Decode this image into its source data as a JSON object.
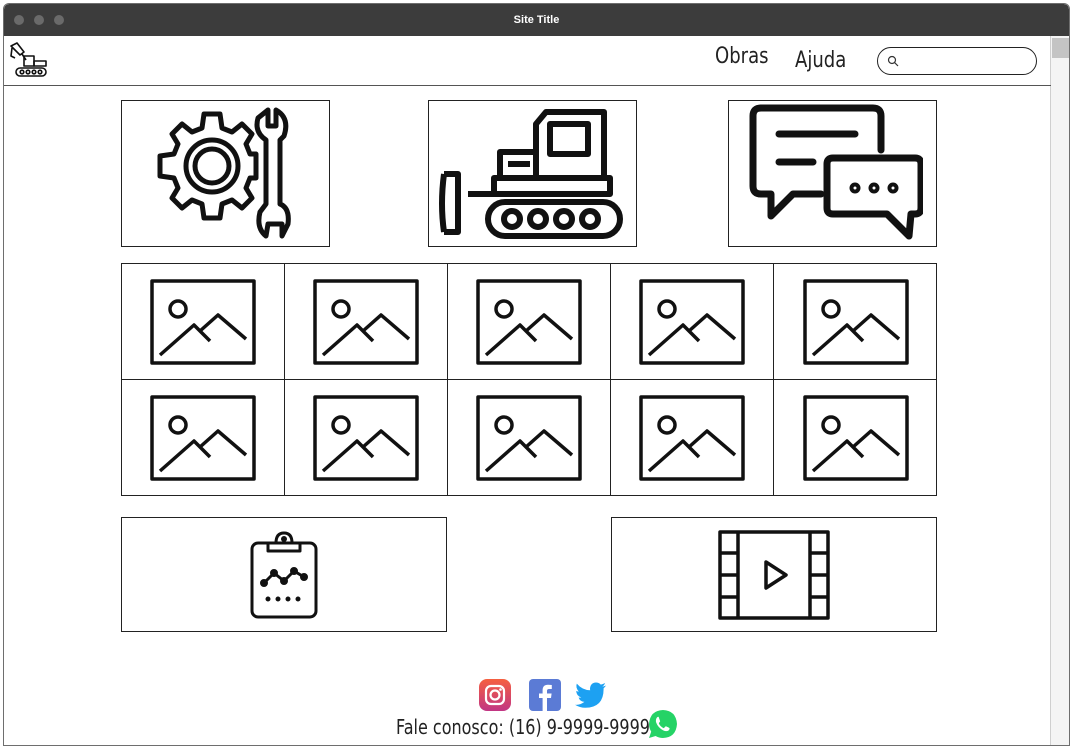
{
  "window": {
    "title": "Site Title"
  },
  "nav": {
    "links": [
      {
        "label": "Obras"
      },
      {
        "label": "Ajuda"
      }
    ],
    "search": {
      "value": "",
      "placeholder": ""
    }
  },
  "feature_tiles": [
    {
      "icon": "settings-wrench-icon"
    },
    {
      "icon": "bulldozer-icon"
    },
    {
      "icon": "chat-bubbles-icon"
    }
  ],
  "gallery": {
    "rows": 2,
    "columns": 5,
    "icon": "image-placeholder-icon"
  },
  "bottom_tiles": [
    {
      "icon": "clipboard-chart-icon"
    },
    {
      "icon": "video-film-icon"
    }
  ],
  "footer": {
    "social": [
      "instagram-icon",
      "facebook-icon",
      "twitter-icon"
    ],
    "contact": "Fale conosco: (16) 9-9999-9999",
    "whatsapp": "whatsapp-icon"
  },
  "colors": {
    "titlebar": "#3c3c3c",
    "instagram_top": "#f56040",
    "instagram_bottom": "#c13584",
    "facebook": "#5b7bd5",
    "twitter": "#1da1f2",
    "whatsapp": "#25d366"
  }
}
